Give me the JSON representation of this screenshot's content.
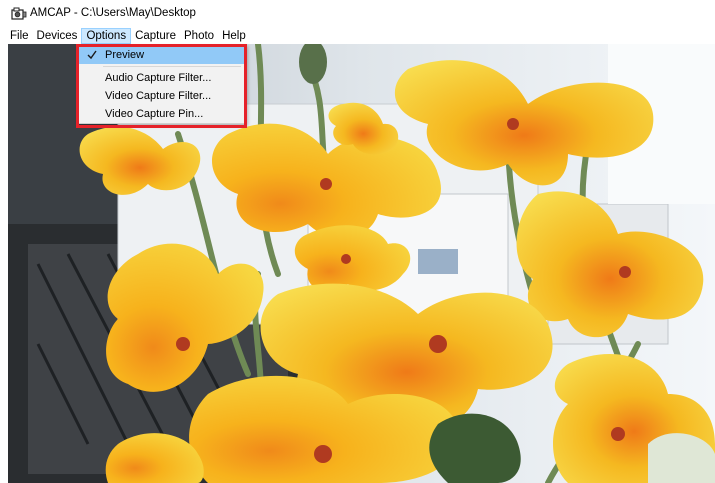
{
  "window": {
    "title": "AMCAP - C:\\Users\\May\\Desktop",
    "icon": "camera-app-icon"
  },
  "menubar": {
    "items": [
      "File",
      "Devices",
      "Options",
      "Capture",
      "Photo",
      "Help"
    ],
    "active": "Options"
  },
  "options_menu": {
    "items": [
      {
        "label": "Preview",
        "checked": true
      },
      {
        "label": "Audio Capture Filter...",
        "checked": false
      },
      {
        "label": "Video Capture Filter...",
        "checked": false
      },
      {
        "label": "Video Capture Pin...",
        "checked": false
      }
    ]
  },
  "colors": {
    "menu_active_bg": "#cce8ff",
    "menu_highlight": "#91c9f7",
    "annotation_box": "#e5222a",
    "flower_yellow": "#f5c818",
    "flower_orange": "#f08a1a"
  }
}
